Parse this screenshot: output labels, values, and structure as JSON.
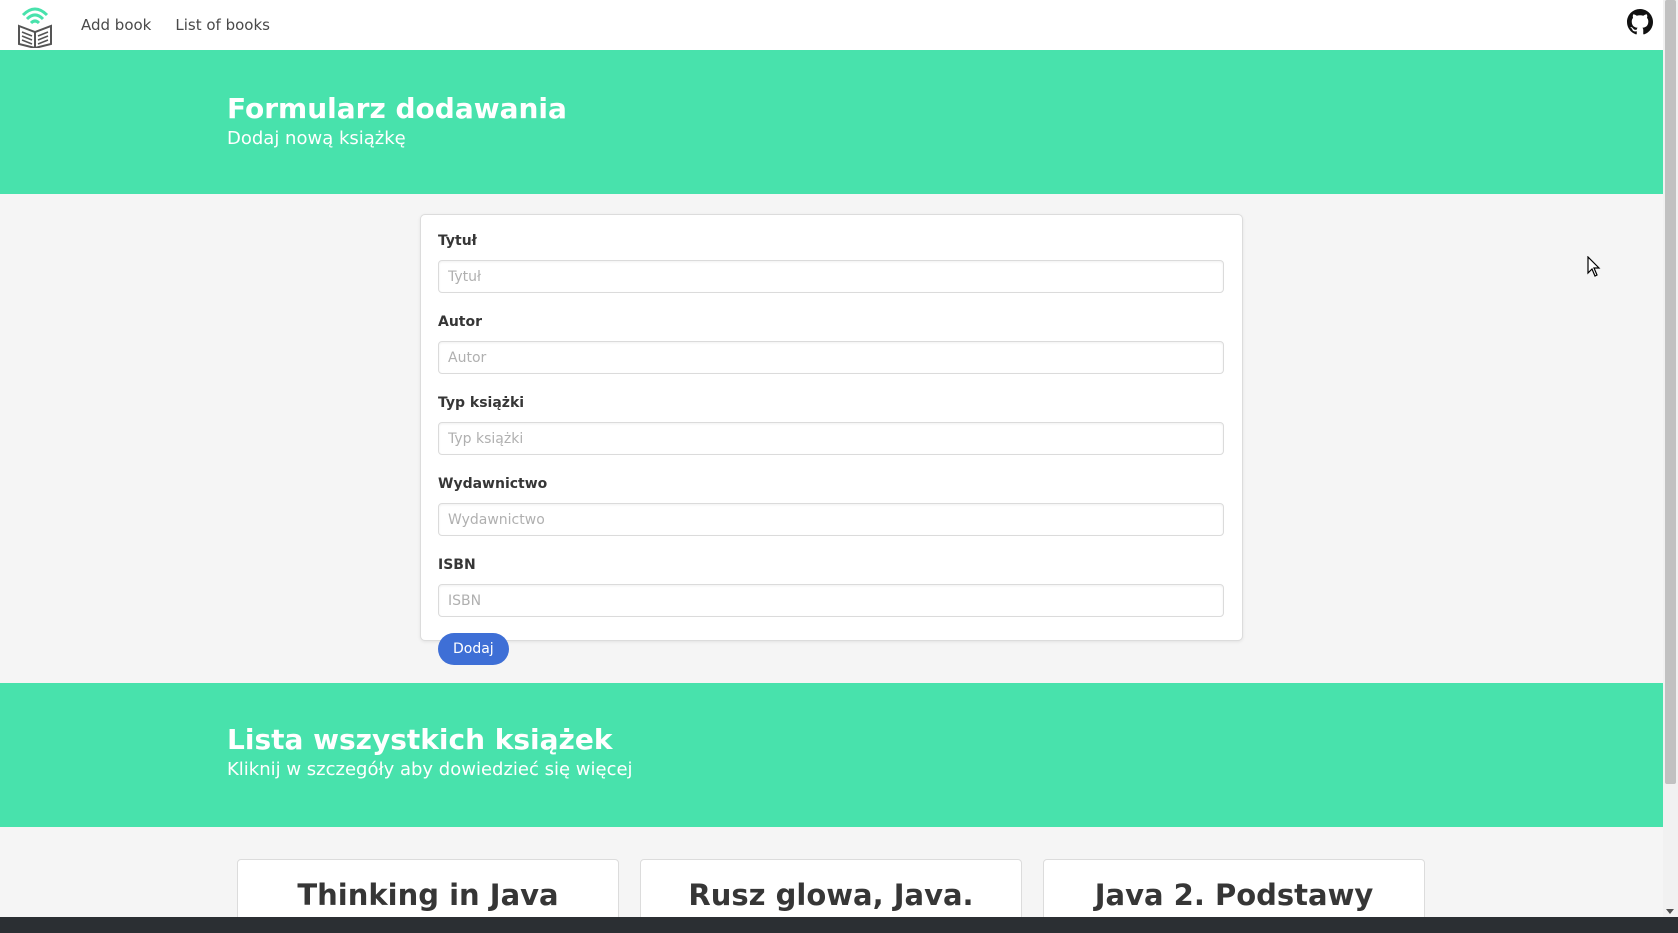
{
  "navbar": {
    "logo_icon": "books-logo-icon",
    "links": [
      {
        "label": "Add book"
      },
      {
        "label": "List of books"
      }
    ],
    "github_icon": "github-icon"
  },
  "hero_add": {
    "title": "Formularz dodawania",
    "subtitle": "Dodaj nową książkę"
  },
  "form": {
    "fields": [
      {
        "label": "Tytuł",
        "placeholder": "Tytuł",
        "value": ""
      },
      {
        "label": "Autor",
        "placeholder": "Autor",
        "value": ""
      },
      {
        "label": "Typ książki",
        "placeholder": "Typ książki",
        "value": ""
      },
      {
        "label": "Wydawnictwo",
        "placeholder": "Wydawnictwo",
        "value": ""
      },
      {
        "label": "ISBN",
        "placeholder": "ISBN",
        "value": ""
      }
    ],
    "submit_label": "Dodaj"
  },
  "hero_list": {
    "title": "Lista wszystkich książek",
    "subtitle": "Kliknij w szczegóły aby dowiedzieć się więcej"
  },
  "books": [
    {
      "title": "Thinking in Java"
    },
    {
      "title": "Rusz glowa, Java."
    },
    {
      "title": "Java 2. Podstawy"
    }
  ],
  "colors": {
    "accent": "#48e2ac",
    "button": "#3e6fd6"
  }
}
